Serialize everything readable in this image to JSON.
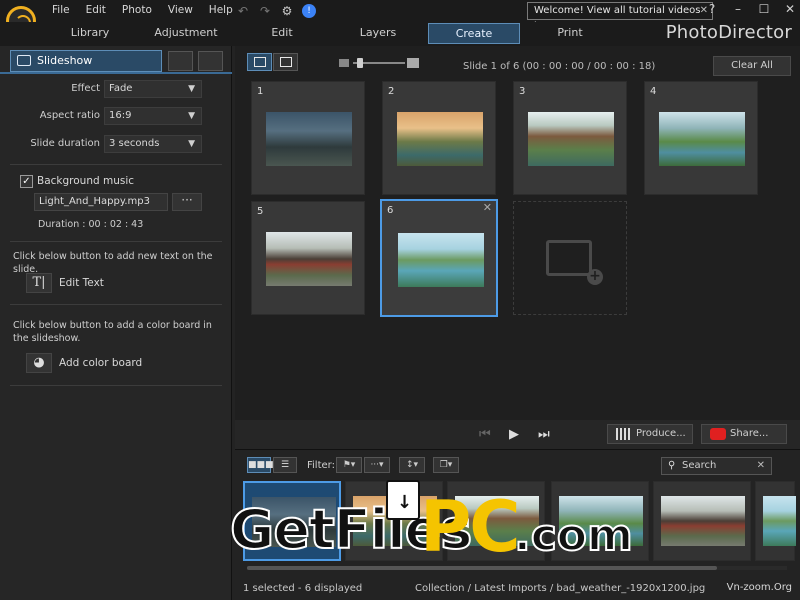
{
  "app": {
    "brand": "PhotoDirector",
    "menu": [
      "File",
      "Edit",
      "Photo",
      "View",
      "Help"
    ],
    "welcome": "Welcome! View all tutorial videos here!",
    "mode_tabs": [
      "Library",
      "Adjustment",
      "Edit",
      "Layers",
      "Create",
      "Print"
    ],
    "active_mode": "Create",
    "accent": "#2a4a66",
    "selection_color": "#4d9be6"
  },
  "left_panel": {
    "tab_label": "Slideshow",
    "effect": {
      "label": "Effect",
      "value": "Fade"
    },
    "aspect": {
      "label": "Aspect ratio",
      "value": "16:9"
    },
    "duration": {
      "label": "Slide duration",
      "value": "3 seconds"
    },
    "music": {
      "label": "Background music",
      "checked": true,
      "file": "Light_And_Happy.mp3",
      "browse": "···",
      "duration": "Duration : 00 : 02 : 43"
    },
    "text_hint": "Click below button to add new text on the slide.",
    "edit_text": "Edit Text",
    "color_hint": "Click below button to add a color board in the slideshow.",
    "add_color": "Add color board"
  },
  "main": {
    "slide_info": "Slide    1  of    6 (00 : 00 : 00 / 00 : 00 : 18)",
    "clear_all": "Clear All",
    "slides": [
      {
        "num": "1"
      },
      {
        "num": "2"
      },
      {
        "num": "3"
      },
      {
        "num": "4"
      },
      {
        "num": "5"
      },
      {
        "num": "6"
      }
    ],
    "selected_slide": "6",
    "close_icon": "✕",
    "produce": "Produce...",
    "share": "Share..."
  },
  "library": {
    "filter_label": "Filter:",
    "search_placeholder": "Search",
    "status_left": "1 selected - 6 displayed",
    "status_path": "Collection / Latest Imports / bad_weather_-1920x1200.jpg"
  },
  "watermark": {
    "a": "GetFiles",
    "b": "PC",
    "c": ".com",
    "site": "Vn-zoom.Org"
  }
}
